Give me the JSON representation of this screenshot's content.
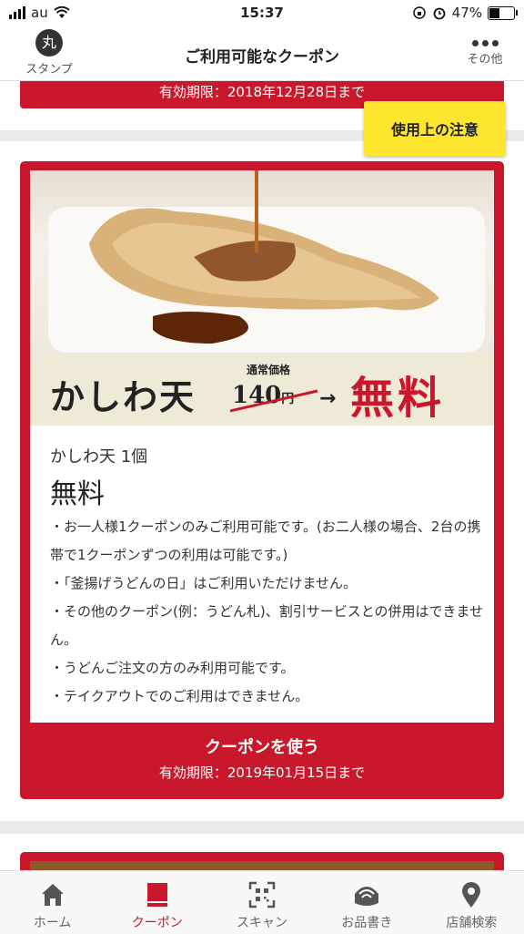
{
  "status_bar": {
    "carrier": "au",
    "time": "15:37",
    "battery": "47%",
    "battery_level": 0.47
  },
  "header": {
    "stamp_logo": "丸",
    "stamp_label": "スタンプ",
    "title": "ご利用可能なクーポン",
    "more_label": "その他"
  },
  "previous_coupon": {
    "expiry": "有効期限：2018年12月28日まで"
  },
  "caution_button": "使用上の注意",
  "coupon": {
    "banner": {
      "name": "かしわ天",
      "usual_price_label": "通常価格",
      "usual_price": "140",
      "yen": "円",
      "arrow": "→",
      "free": "無料"
    },
    "product_title": "かしわ天 1個",
    "price": "無料",
    "notes": [
      "・お一人様1クーポンのみご利用可能です。(お二人様の場合、2台の携帯で1クーポンずつの利用は可能です。)",
      "・「釜揚げうどんの日」はご利用いただけません。",
      "・その他のクーポン(例：うどん札)、割引サービスとの併用はできません。",
      "・うどんご注文の方のみ利用可能です。",
      "・テイクアウトでのご利用はできません。"
    ],
    "use_button": "クーポンを使う",
    "expiry": "有効期限：2019年01月15日まで"
  },
  "tabs": [
    {
      "label": "ホーム",
      "icon": "home-icon"
    },
    {
      "label": "クーポン",
      "icon": "coupon-icon",
      "active": true
    },
    {
      "label": "スキャン",
      "icon": "qr-scan-icon"
    },
    {
      "label": "お品書き",
      "icon": "menu-bowl-icon"
    },
    {
      "label": "店舗検索",
      "icon": "location-pin-icon"
    }
  ],
  "colors": {
    "brand_red": "#c9172c",
    "caution_yellow": "#ffe62e"
  }
}
